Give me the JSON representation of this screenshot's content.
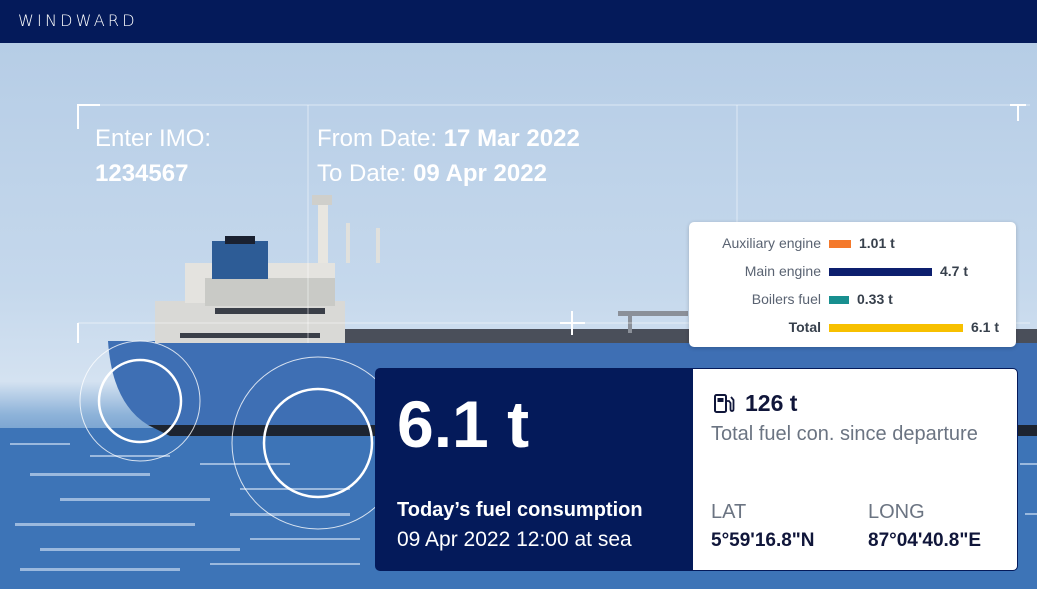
{
  "header": {
    "logo": "WINDWARD"
  },
  "query": {
    "imo_label": "Enter IMO:",
    "imo_value": "1234567",
    "from_label": "From Date:",
    "from_value": "17 Mar 2022",
    "to_label": "To Date:",
    "to_value": "09 Apr 2022"
  },
  "breakdown": {
    "items": [
      {
        "label": "Auxiliary engine",
        "value": 1.01,
        "display": "1.01 t",
        "color": "#f4792b"
      },
      {
        "label": "Main engine",
        "value": 4.7,
        "display": "4.7 t",
        "color": "#0d1f6e"
      },
      {
        "label": "Boilers fuel",
        "value": 0.33,
        "display": "0.33 t",
        "color": "#188f8f"
      },
      {
        "label": "Total",
        "value": 6.1,
        "display": "6.1 t",
        "color": "#f7c000"
      }
    ]
  },
  "today": {
    "value": "6.1 t",
    "title": "Today’s fuel consumption",
    "subtitle": "09 Apr 2022  12:00 at sea"
  },
  "total": {
    "icon": "fuel-pump-icon",
    "value": "126 t",
    "label": "Total fuel con. since departure"
  },
  "position": {
    "lat_label": "LAT",
    "lat_value": "5°59'16.8\"N",
    "long_label": "LONG",
    "long_value": "87°04'40.8\"E"
  },
  "colors": {
    "navy": "#041a5a",
    "white": "#ffffff"
  }
}
